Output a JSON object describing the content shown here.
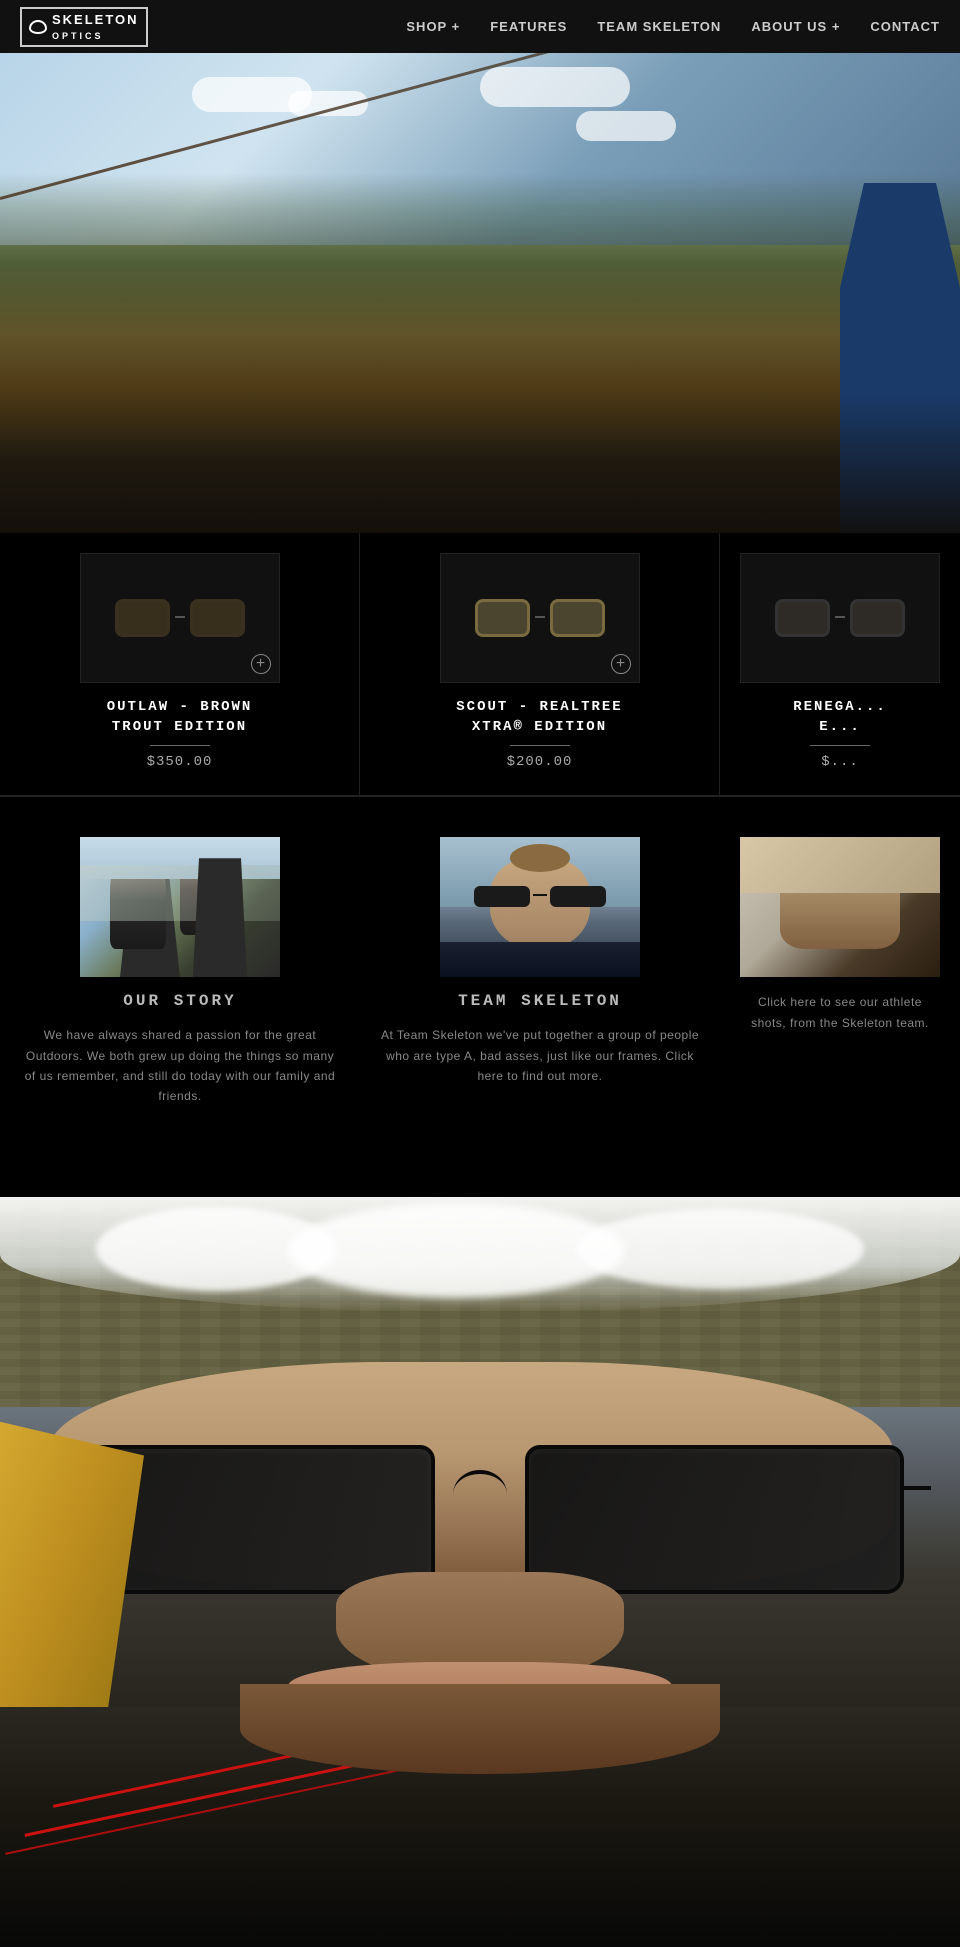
{
  "nav": {
    "logo_text": "SKELETON",
    "logo_sub": "OPTICS",
    "links": [
      {
        "label": "SHOP +",
        "id": "shop"
      },
      {
        "label": "FEATURES",
        "id": "features"
      },
      {
        "label": "TEAM SKELETON",
        "id": "team-skeleton"
      },
      {
        "label": "ABOUT US +",
        "id": "about"
      },
      {
        "label": "CONTACT",
        "id": "contact"
      }
    ]
  },
  "products": {
    "items": [
      {
        "name": "OUTLAW - BROWN\nTROUT EDITION",
        "name_line1": "OUTLAW - BROWN",
        "name_line2": "TROUT EDITION",
        "price": "$350.00",
        "id": "outlaw"
      },
      {
        "name": "SCOUT - REALTREE\nXTRA® EDITION",
        "name_line1": "SCOUT - REALTREE",
        "name_line2": "XTRA® EDITION",
        "price": "$200.00",
        "id": "scout"
      },
      {
        "name": "RENEGA...",
        "name_line1": "RENEGA...",
        "name_line2": "E...",
        "price": "$...",
        "id": "renegade"
      }
    ],
    "add_icon": "+"
  },
  "sections": {
    "our_story": {
      "title": "OUR STORY",
      "description": "We have always shared a passion for the great Outdoors. We both grew up doing the things so many of us remember, and still do today with our family and friends."
    },
    "team_skeleton": {
      "title": "TEAM SKELETON",
      "description": "At Team Skeleton we've put together a group of people who are type A, bad asses, just like our frames. Click here to find out more."
    },
    "third": {
      "title": "",
      "description": "Click here to see our athlete shots, from the Skeleton team."
    }
  }
}
